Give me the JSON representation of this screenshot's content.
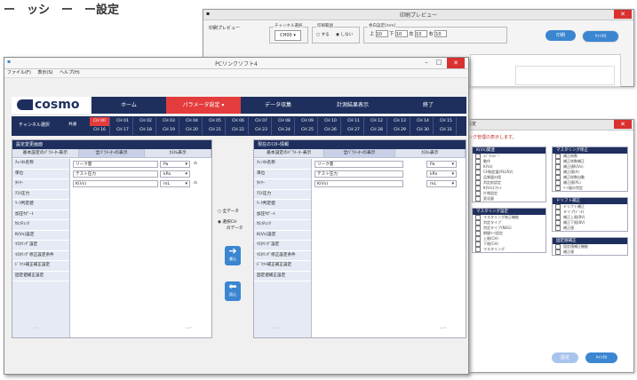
{
  "heading": "ー　ッシ　ー　ー設定",
  "print_preview": {
    "title": "印刷プレビュー",
    "label_left": "印刷プレビュー",
    "channel_group": "チャンネル選択",
    "channel_value": "CH00",
    "range_group": "印刷範囲",
    "range_opt1": "する",
    "range_opt2": "しない",
    "margin_group": "余白設定[mm]",
    "margin_labels": [
      "上",
      "下",
      "左",
      "右"
    ],
    "margin_values": [
      "10",
      "10",
      "10",
      "10"
    ],
    "print_button": "印刷",
    "cancel_button": "ｷｬﾝｾﾙ"
  },
  "settings_window": {
    "title": "設定",
    "message": "ンク管理の表示します。",
    "groups_left": [
      {
        "header": "K(Vs)関連",
        "items": [
          "ｽﾍﾟｸﾄﾙﾊﾞｰ",
          "動作",
          "K(Vs)",
          "CH指定量(PLUSV)",
          "品質量の保",
          "判定前設定",
          "K(Vs)ｵﾌｾｯﾄ",
          "片側設定",
          "変化量"
        ]
      },
      {
        "header": "マスタリング設定",
        "items": [
          "マスタリング修正機能",
          "判定タイプ",
          "判定タイプ(NEG)",
          "期間ﾏｰｸ設定",
          "上限(CH)",
          "下限(CH)",
          "マスタリング"
        ]
      }
    ],
    "groups_right": [
      {
        "header": "マスタリング修正",
        "items": [
          "補正係数",
          "補正係数補正",
          "補正値K(Vs)",
          "補正値(A)",
          "補正係数自動",
          "補正値(PL)",
          "ﾘｰｸ量の判定"
        ]
      },
      {
        "header": "ドリフト補正",
        "items": [
          "ドリフト補正",
          "タイプ(ﾃﾞｰﾀ)",
          "補正上限(BV)",
          "補正下限(BV)",
          "補正値"
        ]
      },
      {
        "header": "固定値補正",
        "items": [
          "固定値補正機能",
          "補正値"
        ]
      }
    ],
    "ok_button": "設定",
    "cancel_button": "ｷｬﾝｾﾙ"
  },
  "main_window": {
    "title": "PCリンクソフト4",
    "menu": [
      "ファイル(F)",
      "表示(S)",
      "ヘルプ(H)"
    ],
    "logo": "cosmo",
    "nav": [
      "ホーム",
      "パラメータ設定 ▾",
      "データ収集",
      "計測結果表示",
      "終了"
    ],
    "channel_label": "チャンネル選択",
    "all_label": "共通",
    "channels_top": [
      "CH 00",
      "CH 01",
      "CH 02",
      "CH 03",
      "CH 04",
      "CH 05",
      "CH 06",
      "CH 07",
      "CH 08",
      "CH 09",
      "CH 10",
      "CH 11",
      "CH 12",
      "CH 13",
      "CH 14",
      "CH 15"
    ],
    "channels_bottom": [
      "CH 16",
      "CH 17",
      "CH 18",
      "CH 19",
      "CH 20",
      "CH 21",
      "CH 22",
      "CH 23",
      "CH 24",
      "CH 25",
      "CH 26",
      "CH 27",
      "CH 28",
      "CH 29",
      "CH 30",
      "CH 31"
    ],
    "left_panel": {
      "header": "設定変更画面",
      "tabs": [
        "基本設定のﾊﾟﾗﾒｰﾀｰ表示",
        "全ﾊﾟﾗﾒｰﾀｰの表示",
        "ｶｽﾀﾑ表示"
      ],
      "rows": [
        "ﾁｬﾝﾈﾙ名称",
        "単位",
        "ﾀｲﾏｰ",
        "ﾃｽﾄ圧力",
        "ﾘｰｸ判定値",
        "加圧ｻﾎﾟｰﾄ",
        "ｾﾙﾌﾁｪｯｸ",
        "K(Vs)設定",
        "ﾏｽﾀﾘﾝｸﾞ設定",
        "ﾏｽﾀﾘﾝｸﾞ修正設定条件",
        "ﾄﾞﾘﾌﾄ補正補正設定",
        "固定値補正設定"
      ],
      "fields": [
        {
          "label": "リーク量",
          "unit": "Pa",
          "rate": "/s"
        },
        {
          "label": "テスト圧力",
          "unit": "kPa",
          "rate": ""
        },
        {
          "label": "K(Vs)",
          "unit": "mL",
          "rate": "/s"
        }
      ]
    },
    "right_panel": {
      "header": "現在のﾏｽﾀｰ情報",
      "tabs": [
        "基本設定のﾊﾟﾗﾒｰﾀｰ表示",
        "全ﾊﾟﾗﾒｰﾀｰの表示",
        "ｶｽﾀﾑ表示"
      ],
      "rows": [
        "ﾁｬﾝﾈﾙ名称",
        "単位",
        "ﾀｲﾏｰ",
        "ﾃｽﾄ圧力",
        "ﾘｰｸ判定値",
        "加圧ｻﾎﾟｰﾄ",
        "ｾﾙﾌﾁｪｯｸ",
        "K(Vs)設定",
        "ﾏｽﾀﾘﾝｸﾞ設定",
        "ﾏｽﾀﾘﾝｸﾞ修正設定条件",
        "ﾄﾞﾘﾌﾄ補正補正設定",
        "固定値補正設定"
      ],
      "fields": [
        {
          "label": "リーク量",
          "unit": "Pa"
        },
        {
          "label": "テスト圧力",
          "unit": "kPa"
        },
        {
          "label": "K(Vs)",
          "unit": "mL"
        }
      ]
    },
    "radio_all": "全データ",
    "radio_selected": "選択CH",
    "radio_sub": "のデータ",
    "write_button": "書込",
    "read_button": "読込",
    "brand_color": "#1e2f5e",
    "accent_color": "#e43c3c"
  }
}
